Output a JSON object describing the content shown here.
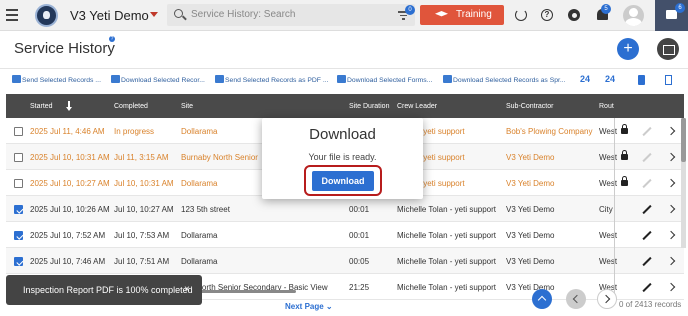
{
  "app": {
    "title": "V3 Yeti Demo",
    "search_placeholder": "Service History: Search",
    "training_label": "Training",
    "filter_badge": "0",
    "notifications_badge": "5",
    "chat_badge": "6",
    "help_glyph": "?",
    "add_glyph": "+"
  },
  "page": {
    "title": "Service History",
    "info_glyph": "?"
  },
  "toolbar": {
    "actions": [
      "Send Selected Records ...",
      "Download Selected Recor...",
      "Send Selected Records as PDF ...",
      "Download Selected Forms...",
      "Download Selected Records as Spr..."
    ],
    "icon_24_a": "24",
    "icon_24_b": "24"
  },
  "table": {
    "headers": [
      "Started",
      "Completed",
      "Site",
      "Site Duration",
      "Crew Leader",
      "Sub-Contractor",
      "Rout"
    ],
    "rows": [
      {
        "checked": false,
        "status": "progress",
        "started": "2025 Jul 11, 4:46 AM",
        "completed": "In progress",
        "site": "Dollarama",
        "duration": "",
        "crew": "Tolan - yeti support",
        "sub": "Bob's Plowing Company",
        "route": "West",
        "locked": true
      },
      {
        "checked": false,
        "status": "progress",
        "started": "2025 Jul 10, 10:31 AM",
        "completed": "Jul 11, 3:15 AM",
        "site": "Burnaby North Senior",
        "duration": "",
        "crew": "Tolan - yeti support",
        "sub": "V3 Yeti Demo",
        "route": "West",
        "locked": true
      },
      {
        "checked": false,
        "status": "progress",
        "started": "2025 Jul 10, 10:27 AM",
        "completed": "Jul 10, 10:31 AM",
        "site": "Dollarama",
        "duration": "",
        "crew": "Tolan - yeti support",
        "sub": "V3 Yeti Demo",
        "route": "West",
        "locked": true
      },
      {
        "checked": true,
        "status": "done",
        "started": "2025 Jul 10, 10:26 AM",
        "completed": "Jul 10, 10:27 AM",
        "site": "123 5th street",
        "duration": "00:01",
        "crew": "Michelle Tolan - yeti support",
        "sub": "V3 Yeti Demo",
        "route": "City",
        "locked": false
      },
      {
        "checked": true,
        "status": "done",
        "started": "2025 Jul 10, 7:52 AM",
        "completed": "Jul 10, 7:53 AM",
        "site": "Dollarama",
        "duration": "00:01",
        "crew": "Michelle Tolan - yeti support",
        "sub": "V3 Yeti Demo",
        "route": "West",
        "locked": false
      },
      {
        "checked": true,
        "status": "done",
        "started": "2025 Jul 10, 7:46 AM",
        "completed": "Jul 10, 7:51 AM",
        "site": "Dollarama",
        "duration": "00:05",
        "crew": "Michelle Tolan - yeti support",
        "sub": "V3 Yeti Demo",
        "route": "West",
        "locked": false
      },
      {
        "checked": false,
        "status": "done",
        "started": "",
        "completed": "",
        "site": "aby North Senior Secondary - Basic View",
        "duration": "21:25",
        "crew": "Michelle Tolan - yeti support",
        "sub": "V3 Yeti Demo",
        "route": "West",
        "locked": false
      }
    ]
  },
  "pagination": {
    "next_label": "Next Page",
    "records": "0 of 2413 records"
  },
  "toast": {
    "message": "Inspection Report PDF is 100% completed",
    "close": "×"
  },
  "modal": {
    "title": "Download",
    "message": "Your file is ready.",
    "button": "Download"
  },
  "colors": {
    "progress_text": "#d9822b",
    "accent": "#2c6fd1",
    "training": "#e0553b"
  }
}
